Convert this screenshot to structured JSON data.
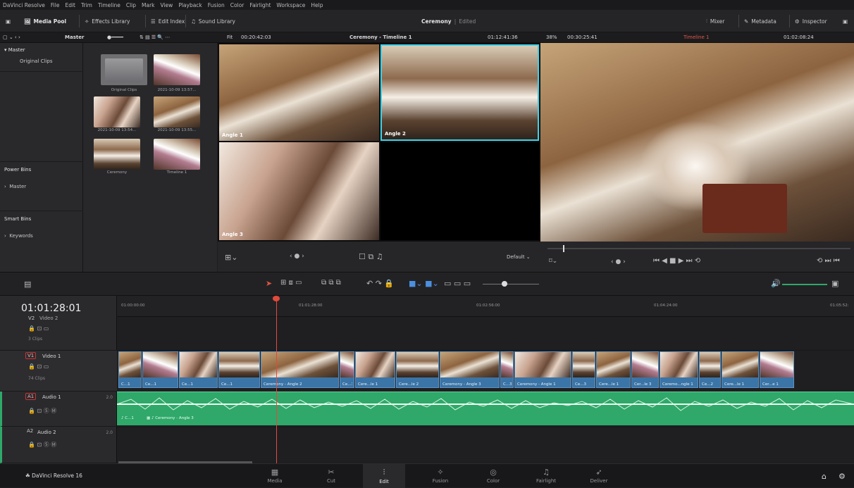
{
  "menu": [
    "DaVinci Resolve",
    "File",
    "Edit",
    "Trim",
    "Timeline",
    "Clip",
    "Mark",
    "View",
    "Playback",
    "Fusion",
    "Color",
    "Fairlight",
    "Workspace",
    "Help"
  ],
  "toolbar": {
    "media_pool": "Media Pool",
    "effects_library": "Effects Library",
    "edit_index": "Edit Index",
    "sound_library": "Sound Library",
    "project_title": "Ceremony",
    "project_status": "Edited",
    "mixer": "Mixer",
    "metadata": "Metadata",
    "inspector": "Inspector"
  },
  "subbar": {
    "bin_name": "Master",
    "fit": "Fit",
    "source_duration": "00:20:42:03",
    "source_title": "Ceremony - Timeline 1",
    "source_timecode": "01:12:41:36",
    "zoom": "38%",
    "record_duration": "00:30:25:41",
    "timeline_dropdown": "Timeline 1",
    "record_timecode": "01:02:08:24"
  },
  "bins": {
    "master": "Master",
    "original_clips": "Original Clips",
    "power_bins": "Power Bins",
    "power_master": "Master",
    "smart_bins": "Smart Bins",
    "keywords": "Keywords"
  },
  "clips": [
    {
      "label": "Original Clips"
    },
    {
      "label": "2021-10-09 13:57..."
    },
    {
      "label": "2021-10-09 13:54..."
    },
    {
      "label": "2021-10-09 13:55..."
    },
    {
      "label": "Ceremony"
    },
    {
      "label": "Timeline 1"
    }
  ],
  "angles": [
    "Angle 1",
    "Angle 2",
    "Angle 3"
  ],
  "source_controls": {
    "default": "Default"
  },
  "timeline": {
    "timecode": "01:01:28:01",
    "ruler": [
      "01:00:00:00",
      "01:01:28:00",
      "01:02:56:00",
      "01:04:24:00",
      "01:05:52:"
    ],
    "tracks": {
      "v2": {
        "badge": "V2",
        "name": "Video 2",
        "count": "3 Clips"
      },
      "v1": {
        "badge": "V1",
        "name": "Video 1",
        "count": "74 Clips"
      },
      "a1": {
        "badge": "A1",
        "name": "Audio 1",
        "channels": "2.0"
      },
      "a2": {
        "badge": "A2",
        "name": "Audio 2",
        "channels": "2.0"
      }
    },
    "video_clips": [
      "C...1",
      "Ce...1",
      "Ce...1",
      "Ce...1",
      "Ceremony - Angle 2",
      "Ce...3",
      "Cere...le 1",
      "Cere...le 2",
      "Ceremony - Angle 3",
      "C...3",
      "Ceremony - Angle 1",
      "Ce...3",
      "Cere...le 1",
      "Cer...le 3",
      "Ceremo...ngle 1",
      "Ce...2",
      "Cere...le 1",
      "Cer...e 1"
    ],
    "audio_clip": "Ceremony - Angle 3",
    "audio_clip_short": "C...1"
  },
  "pages": [
    "Media",
    "Cut",
    "Edit",
    "Fusion",
    "Color",
    "Fairlight",
    "Deliver"
  ],
  "app_name": "DaVinci Resolve 16",
  "colors": {
    "accent": "#2fa86a",
    "selection": "#3fd0e6",
    "playhead": "#e24a3a",
    "video_clip": "#3b74a6"
  }
}
